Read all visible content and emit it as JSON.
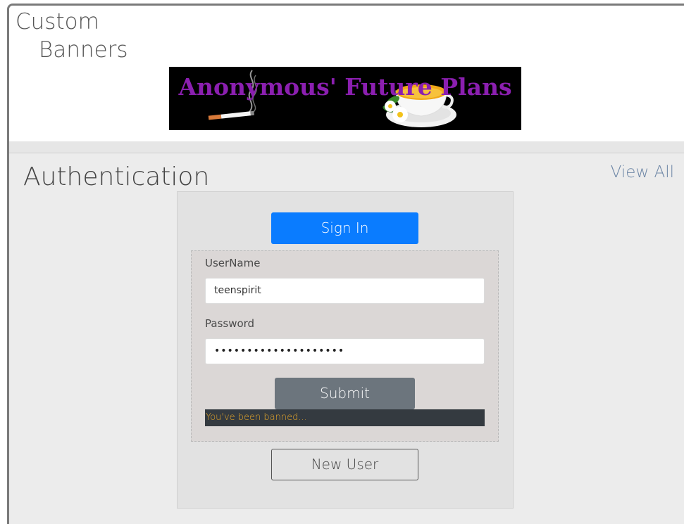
{
  "banners": {
    "title_line1": "Custom",
    "title_line2": "Banners",
    "banner_text": "Anonymous' Future Plans",
    "banner_text_color": "#8b1fb0"
  },
  "auth": {
    "title": "Authentication",
    "view_all": "View All",
    "sign_in_label": "Sign In",
    "username_label": "UserName",
    "username_value": "teenspirit",
    "password_label": "Password",
    "password_value": "••••••••••••••••••••",
    "submit_label": "Submit",
    "error_message": "You've been banned...",
    "new_user_label": "New User"
  },
  "colors": {
    "sign_in_bg": "#0a7cff",
    "submit_bg": "#6c757d",
    "error_bg": "#343a40",
    "error_text": "#e6a72a",
    "view_all": "#6d86a6"
  }
}
